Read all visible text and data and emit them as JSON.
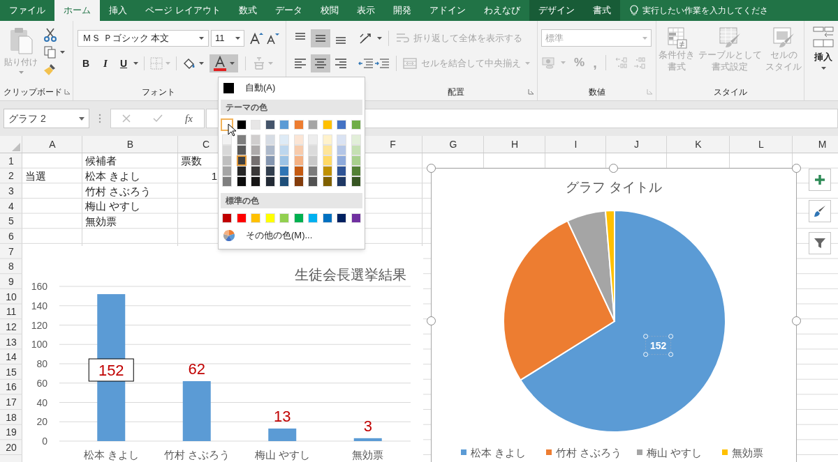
{
  "tabs": [
    {
      "label": "ファイル",
      "selected": false,
      "contextual": false
    },
    {
      "label": "ホーム",
      "selected": true,
      "contextual": false
    },
    {
      "label": "挿入",
      "selected": false,
      "contextual": false
    },
    {
      "label": "ページ レイアウト",
      "selected": false,
      "contextual": false
    },
    {
      "label": "数式",
      "selected": false,
      "contextual": false
    },
    {
      "label": "データ",
      "selected": false,
      "contextual": false
    },
    {
      "label": "校閲",
      "selected": false,
      "contextual": false
    },
    {
      "label": "表示",
      "selected": false,
      "contextual": false
    },
    {
      "label": "開発",
      "selected": false,
      "contextual": false
    },
    {
      "label": "アドイン",
      "selected": false,
      "contextual": false
    },
    {
      "label": "わえなび",
      "selected": false,
      "contextual": false
    },
    {
      "label": "デザイン",
      "selected": false,
      "contextual": true
    },
    {
      "label": "書式",
      "selected": false,
      "contextual": true
    }
  ],
  "search": {
    "placeholder": "実行したい作業を入力してくださ"
  },
  "ribbon": {
    "clipboard": {
      "paste": "貼り付け",
      "label": "クリップボード"
    },
    "font": {
      "name": "ＭＳ Ｐゴシック 本文",
      "size": "11",
      "bold": "B",
      "italic": "I",
      "underline": "U",
      "font_color": {
        "expanded": true
      },
      "label": "フォント"
    },
    "alignment": {
      "vertical_align": [
        {
          "selected": false
        },
        {
          "selected": true
        },
        {
          "selected": false
        }
      ],
      "horizontal_align": [
        {
          "selected": false
        },
        {
          "selected": true
        },
        {
          "selected": false
        }
      ],
      "wrap": {
        "text": "折り返して全体を表示する",
        "disabled": true
      },
      "merge": {
        "text": "セルを結合して中央揃え",
        "disabled": true
      },
      "label": "配置"
    },
    "number": {
      "format": {
        "value": "標準",
        "disabled": true
      },
      "percent": "%",
      "comma": ",",
      "label": "数値"
    },
    "styles": {
      "buttons": [
        {
          "lines": [
            "条件付き",
            "書式"
          ],
          "disabled": true
        },
        {
          "lines": [
            "テーブルとして",
            "書式設定"
          ],
          "disabled": true
        },
        {
          "lines": [
            "セルの",
            "スタイル"
          ],
          "disabled": true
        }
      ],
      "label": "スタイル"
    },
    "cells": {
      "insert": "挿入"
    }
  },
  "formula_bar": {
    "name_box": "グラフ 2",
    "fx": "fx"
  },
  "sheet": {
    "columns": [
      "A",
      "B",
      "C",
      "F",
      "G",
      "H",
      "I",
      "J",
      "K",
      "L",
      "M"
    ],
    "rows": [
      {
        "header": "1",
        "cells": {
          "B": {
            "text": "候補者",
            "kind": "text"
          },
          "C": {
            "text": "票数",
            "kind": "text"
          }
        }
      },
      {
        "header": "2",
        "cells": {
          "A": {
            "text": "当選",
            "kind": "text"
          },
          "B": {
            "text": "松本 きよし",
            "kind": "text"
          },
          "C": {
            "text": "1",
            "kind": "number"
          }
        }
      },
      {
        "header": "3",
        "cells": {
          "B": {
            "text": "竹村 さぶろう",
            "kind": "text"
          }
        }
      },
      {
        "header": "4",
        "cells": {
          "B": {
            "text": "梅山 やすし",
            "kind": "text"
          }
        }
      },
      {
        "header": "5",
        "cells": {
          "B": {
            "text": "無効票",
            "kind": "text"
          }
        }
      },
      {
        "header": "6"
      },
      {
        "header": "7"
      },
      {
        "header": "8"
      },
      {
        "header": "9"
      },
      {
        "header": "10"
      },
      {
        "header": "11"
      },
      {
        "header": "12"
      },
      {
        "header": "13"
      },
      {
        "header": "14"
      },
      {
        "header": "15"
      },
      {
        "header": "16"
      },
      {
        "header": "17"
      },
      {
        "header": "18"
      },
      {
        "header": "19"
      },
      {
        "header": "20"
      }
    ]
  },
  "bar_chart": {
    "chart_data": {
      "type": "bar",
      "title": "生徒会長選挙結果",
      "categories": [
        "松本 きよし",
        "竹村 さぶろう",
        "梅山 やすし",
        "無効票"
      ],
      "series": [
        {
          "color": "#5b9bd5",
          "values": [
            152,
            62,
            13,
            3
          ]
        }
      ],
      "ylim": [
        0,
        160
      ],
      "yticks": [
        {
          "value": 0,
          "label": "0"
        },
        {
          "value": 20,
          "label": "20"
        },
        {
          "value": 40,
          "label": "40"
        },
        {
          "value": 60,
          "label": "60"
        },
        {
          "value": 80,
          "label": "80"
        },
        {
          "value": 100,
          "label": "100"
        },
        {
          "value": 120,
          "label": "120"
        },
        {
          "value": 140,
          "label": "140"
        },
        {
          "value": 160,
          "label": "160"
        }
      ],
      "grid": true,
      "value_labels": [
        "152",
        "62",
        "13",
        "3"
      ]
    },
    "label_selected": [
      true,
      false,
      false,
      false
    ]
  },
  "pie_chart": {
    "selected": true,
    "chart_data": {
      "type": "pie",
      "title": "グラフ タイトル",
      "categories": [
        "松本 きよし",
        "竹村 さぶろう",
        "梅山 やすし",
        "無効票"
      ],
      "series": [
        {
          "values": [
            66.09,
            26.96,
            5.65,
            1.3
          ]
        }
      ],
      "colors": [
        "#5b9bd5",
        "#ed7d31",
        "#a5a5a5",
        "#ffc000"
      ],
      "value_labels": [
        "152",
        null,
        null,
        null
      ],
      "legend": true
    },
    "data_label_selected": true
  },
  "color_menu": {
    "automatic": "自動(A)",
    "theme_header": "テーマの色",
    "theme_colors": [
      [
        {
          "color": "#ffffff",
          "selected": false,
          "hovered": true
        },
        {
          "color": "#000000",
          "selected": false,
          "hovered": false
        },
        {
          "color": "#e7e6e6",
          "selected": false,
          "hovered": false
        },
        {
          "color": "#44546a",
          "selected": false,
          "hovered": false
        },
        {
          "color": "#5b9bd5",
          "selected": false,
          "hovered": false
        },
        {
          "color": "#ed7d31",
          "selected": false,
          "hovered": false
        },
        {
          "color": "#a5a5a5",
          "selected": false,
          "hovered": false
        },
        {
          "color": "#ffc000",
          "selected": false,
          "hovered": false
        },
        {
          "color": "#4472c4",
          "selected": false,
          "hovered": false
        },
        {
          "color": "#70ad47",
          "selected": false,
          "hovered": false
        }
      ],
      [
        {
          "color": "#f2f2f2",
          "selected": false,
          "hovered": false
        },
        {
          "color": "#7f7f7f",
          "selected": false,
          "hovered": false
        },
        {
          "color": "#d0cece",
          "selected": false,
          "hovered": false
        },
        {
          "color": "#d6dce4",
          "selected": false,
          "hovered": false
        },
        {
          "color": "#deebf6",
          "selected": false,
          "hovered": false
        },
        {
          "color": "#fbe5d5",
          "selected": false,
          "hovered": false
        },
        {
          "color": "#ededed",
          "selected": false,
          "hovered": false
        },
        {
          "color": "#fff2cc",
          "selected": false,
          "hovered": false
        },
        {
          "color": "#dae3f3",
          "selected": false,
          "hovered": false
        },
        {
          "color": "#e2efd9",
          "selected": false,
          "hovered": false
        }
      ],
      [
        {
          "color": "#d8d8d8",
          "selected": false,
          "hovered": false
        },
        {
          "color": "#595959",
          "selected": false,
          "hovered": false
        },
        {
          "color": "#aeabab",
          "selected": false,
          "hovered": false
        },
        {
          "color": "#adb9ca",
          "selected": false,
          "hovered": false
        },
        {
          "color": "#bdd7ee",
          "selected": false,
          "hovered": false
        },
        {
          "color": "#f7cbac",
          "selected": false,
          "hovered": false
        },
        {
          "color": "#dbdbdb",
          "selected": false,
          "hovered": false
        },
        {
          "color": "#fee599",
          "selected": false,
          "hovered": false
        },
        {
          "color": "#b4c6e7",
          "selected": false,
          "hovered": false
        },
        {
          "color": "#c5e0b3",
          "selected": false,
          "hovered": false
        }
      ],
      [
        {
          "color": "#bfbfbf",
          "selected": false,
          "hovered": false
        },
        {
          "color": "#3f3f3f",
          "selected": true,
          "hovered": false
        },
        {
          "color": "#757070",
          "selected": false,
          "hovered": false
        },
        {
          "color": "#8496b0",
          "selected": false,
          "hovered": false
        },
        {
          "color": "#9cc3e5",
          "selected": false,
          "hovered": false
        },
        {
          "color": "#f4b183",
          "selected": false,
          "hovered": false
        },
        {
          "color": "#c9c9c9",
          "selected": false,
          "hovered": false
        },
        {
          "color": "#ffd965",
          "selected": false,
          "hovered": false
        },
        {
          "color": "#8eaadb",
          "selected": false,
          "hovered": false
        },
        {
          "color": "#a8d08d",
          "selected": false,
          "hovered": false
        }
      ],
      [
        {
          "color": "#a5a5a5",
          "selected": false,
          "hovered": false
        },
        {
          "color": "#262626",
          "selected": false,
          "hovered": false
        },
        {
          "color": "#3a3838",
          "selected": false,
          "hovered": false
        },
        {
          "color": "#323f4f",
          "selected": false,
          "hovered": false
        },
        {
          "color": "#2e75b5",
          "selected": false,
          "hovered": false
        },
        {
          "color": "#c55a11",
          "selected": false,
          "hovered": false
        },
        {
          "color": "#7b7b7b",
          "selected": false,
          "hovered": false
        },
        {
          "color": "#bf9000",
          "selected": false,
          "hovered": false
        },
        {
          "color": "#2f5496",
          "selected": false,
          "hovered": false
        },
        {
          "color": "#538135",
          "selected": false,
          "hovered": false
        }
      ],
      [
        {
          "color": "#7f7f7f",
          "selected": false,
          "hovered": false
        },
        {
          "color": "#0c0c0c",
          "selected": false,
          "hovered": false
        },
        {
          "color": "#171616",
          "selected": false,
          "hovered": false
        },
        {
          "color": "#222a35",
          "selected": false,
          "hovered": false
        },
        {
          "color": "#1e4e79",
          "selected": false,
          "hovered": false
        },
        {
          "color": "#833c0b",
          "selected": false,
          "hovered": false
        },
        {
          "color": "#525252",
          "selected": false,
          "hovered": false
        },
        {
          "color": "#7f6000",
          "selected": false,
          "hovered": false
        },
        {
          "color": "#1f3864",
          "selected": false,
          "hovered": false
        },
        {
          "color": "#375623",
          "selected": false,
          "hovered": false
        }
      ]
    ],
    "standard_header": "標準の色",
    "standard_colors": [
      {
        "color": "#c00000",
        "selected": false
      },
      {
        "color": "#ff0000",
        "selected": false
      },
      {
        "color": "#ffc000",
        "selected": false
      },
      {
        "color": "#ffff00",
        "selected": false
      },
      {
        "color": "#92d050",
        "selected": false
      },
      {
        "color": "#00b050",
        "selected": false
      },
      {
        "color": "#00b0f0",
        "selected": false
      },
      {
        "color": "#0070c0",
        "selected": false
      },
      {
        "color": "#002060",
        "selected": false
      },
      {
        "color": "#7030a0",
        "selected": false
      }
    ],
    "more_colors": "その他の色(M)..."
  }
}
